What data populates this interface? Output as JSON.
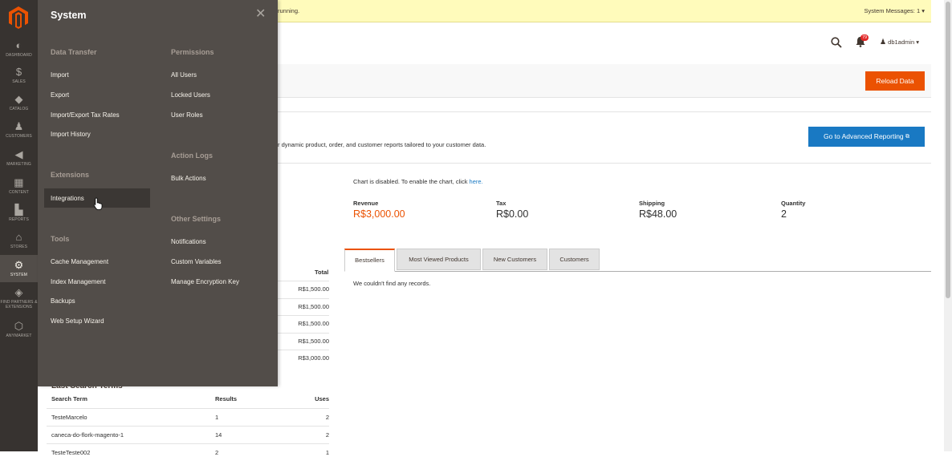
{
  "nav": {
    "items": [
      {
        "label": "DASHBOARD",
        "icon": "dashboard-icon"
      },
      {
        "label": "SALES",
        "icon": "dollar-icon"
      },
      {
        "label": "CATALOG",
        "icon": "box-icon"
      },
      {
        "label": "CUSTOMERS",
        "icon": "person-icon"
      },
      {
        "label": "MARKETING",
        "icon": "megaphone-icon"
      },
      {
        "label": "CONTENT",
        "icon": "layout-icon"
      },
      {
        "label": "REPORTS",
        "icon": "bar-chart-icon"
      },
      {
        "label": "STORES",
        "icon": "store-icon"
      },
      {
        "label": "SYSTEM",
        "icon": "gear-icon"
      },
      {
        "label": "FIND PARTNERS & EXTENSIONS",
        "icon": "cube-icon"
      },
      {
        "label": "ANYMARKET",
        "icon": "hexagon-icon"
      }
    ]
  },
  "flyout": {
    "title": "System",
    "col1": {
      "data_transfer": {
        "title": "Data Transfer",
        "links": [
          "Import",
          "Export",
          "Import/Export Tax Rates",
          "Import History"
        ]
      },
      "extensions": {
        "title": "Extensions",
        "links": [
          "Integrations"
        ]
      },
      "tools": {
        "title": "Tools",
        "links": [
          "Cache Management",
          "Index Management",
          "Backups",
          "Web Setup Wizard"
        ]
      }
    },
    "col2": {
      "permissions": {
        "title": "Permissions",
        "links": [
          "All Users",
          "Locked Users",
          "User Roles"
        ]
      },
      "action_logs": {
        "title": "Action Logs",
        "links": [
          "Bulk Actions"
        ]
      },
      "other_settings": {
        "title": "Other Settings",
        "links": [
          "Notifications",
          "Custom Variables",
          "Manage Encryption Key"
        ]
      }
    }
  },
  "message_bar": {
    "text": "running.",
    "system_messages": "System Messages: 1"
  },
  "header": {
    "notif_count": "79",
    "username": "db1admin"
  },
  "page_actions": {
    "reload": "Reload Data"
  },
  "advanced": {
    "text": "r dynamic product, order, and customer reports tailored to your customer data.",
    "button": "Go to Advanced Reporting"
  },
  "chart_notice": {
    "text": "Chart is disabled. To enable the chart, click ",
    "link": "here."
  },
  "metrics": [
    {
      "label": "Revenue",
      "value": "R$3,000.00"
    },
    {
      "label": "Tax",
      "value": "R$0.00"
    },
    {
      "label": "Shipping",
      "value": "R$48.00"
    },
    {
      "label": "Quantity",
      "value": "2"
    }
  ],
  "tabs": [
    "Bestsellers",
    "Most Viewed Products",
    "New Customers",
    "Customers"
  ],
  "tab_content": "We couldn't find any records.",
  "last_orders": {
    "header": "Total",
    "values": [
      "R$1,500.00",
      "R$1,500.00",
      "R$1,500.00",
      "R$1,500.00",
      "R$3,000.00"
    ]
  },
  "last_search": {
    "title": "Last Search Terms",
    "headers": [
      "Search Term",
      "Results",
      "Uses"
    ],
    "rows": [
      [
        "TesteMarcelo",
        "1",
        "2"
      ],
      [
        "caneca-do-flork-magento-1",
        "14",
        "2"
      ],
      [
        "TesteTeste002",
        "2",
        "1"
      ]
    ]
  }
}
